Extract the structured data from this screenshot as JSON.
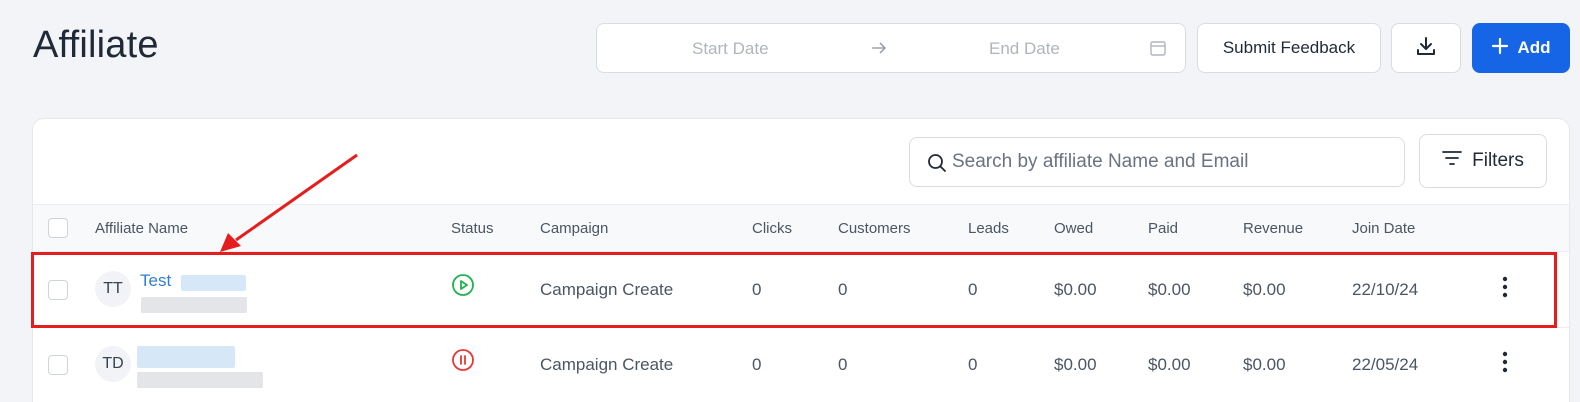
{
  "page": {
    "title": "Affiliate"
  },
  "date_range": {
    "start_placeholder": "Start Date",
    "end_placeholder": "End Date",
    "arrow_icon": "arrow-right-icon",
    "calendar_icon": "calendar-icon"
  },
  "toolbar": {
    "feedback_label": "Submit Feedback",
    "download_icon": "download-icon",
    "add_label": "Add",
    "add_icon": "plus-icon"
  },
  "search": {
    "placeholder": "Search by affiliate Name and Email",
    "icon": "search-icon"
  },
  "filters": {
    "label": "Filters",
    "icon": "filter-lines-icon"
  },
  "table": {
    "columns": [
      "Affiliate Name",
      "Status",
      "Campaign",
      "Clicks",
      "Customers",
      "Leads",
      "Owed",
      "Paid",
      "Revenue",
      "Join Date"
    ],
    "rows": [
      {
        "initials": "TT",
        "name": "Test",
        "status": "active",
        "status_icon": "play-circle-icon",
        "campaign": "Campaign Create",
        "clicks": "0",
        "customers": "0",
        "leads": "0",
        "owed": "$0.00",
        "paid": "$0.00",
        "revenue": "$0.00",
        "join_date": "22/10/24",
        "highlighted": true
      },
      {
        "initials": "TD",
        "name": "",
        "status": "paused",
        "status_icon": "pause-circle-icon",
        "campaign": "Campaign Create",
        "clicks": "0",
        "customers": "0",
        "leads": "0",
        "owed": "$0.00",
        "paid": "$0.00",
        "revenue": "$0.00",
        "join_date": "22/05/24",
        "highlighted": false
      }
    ]
  },
  "colors": {
    "accent": "#1565e6",
    "link": "#2f7fd2",
    "active": "#22b14c",
    "paused": "#e53935",
    "annotation": "#e51d1d"
  }
}
